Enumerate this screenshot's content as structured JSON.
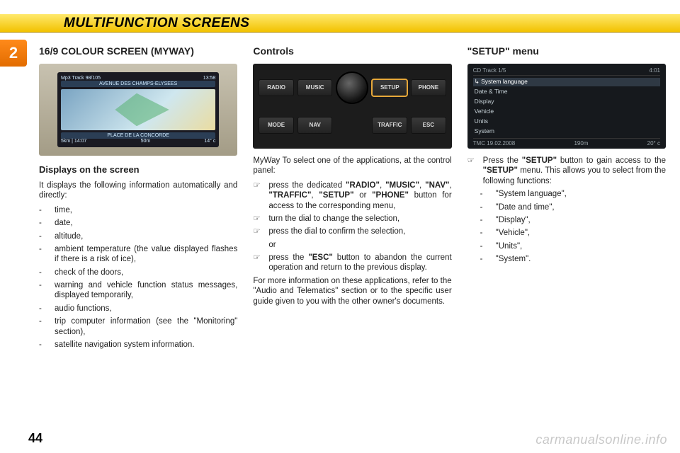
{
  "header": {
    "title": "MULTIFUNCTION SCREENS"
  },
  "chapter": "2",
  "pagenum": "44",
  "watermark": "carmanualsonline.info",
  "col1": {
    "heading": "16/9 COLOUR SCREEN (MYWAY)",
    "screen": {
      "topleft": "Mp3   Track  98/105",
      "topright": "13:58",
      "title": "AVENUE DES CHAMPS-ELYSEES",
      "sub": "PLACE DE LA CONCORDE",
      "botleft": "5km | 14:07",
      "botmid": "50m",
      "botright": "14° c"
    },
    "subheading": "Displays on the screen",
    "intro": "It displays the following information automatically and directly:",
    "items": [
      "time,",
      "date,",
      "altitude,",
      "ambient temperature (the value displayed flashes if there is a risk of ice),",
      "check of the doors,",
      "warning and vehicle function status messages, displayed temporarily,",
      "audio functions,",
      "trip computer information (see the \"Monitoring\" section),",
      "satellite navigation system information."
    ]
  },
  "col2": {
    "heading": "Controls",
    "buttons_row1": [
      "RADIO",
      "MUSIC",
      "",
      "SETUP",
      "PHONE"
    ],
    "buttons_row2": [
      "MODE",
      "NAV",
      "",
      "TRAFFIC",
      "ESC"
    ],
    "intro": "MyWay To select one of the applications, at the control panel:",
    "steps": [
      {
        "pre": "press the dedicated ",
        "bold": "\"RADIO\"",
        "mid1": ", ",
        "bold2": "\"MUSIC\"",
        "mid2": ", ",
        "bold3": "\"NAV\"",
        "mid3": ", ",
        "bold4": "\"TRAFFIC\"",
        "mid4": ", ",
        "bold5": "\"SETUP\"",
        "mid5": " or ",
        "bold6": "\"PHONE\"",
        "post": " button for access to the corresponding menu,"
      },
      {
        "pre": "turn the dial to change the selection,"
      },
      {
        "pre": "press the dial to confirm the selection,"
      },
      {
        "pre": "or"
      },
      {
        "pre": "press the ",
        "bold": "\"ESC\"",
        "post": " button to abandon the current operation and return to the previous display."
      }
    ],
    "outro": "For more information on these applications, refer to the \"Audio and Telematics\" section or to the specific user guide given to you with the other owner's documents."
  },
  "col3": {
    "heading": "\"SETUP\" menu",
    "screen": {
      "topleft": "CD    Track 1/5",
      "topright": "4:01",
      "menu": [
        "System language",
        "Date & Time",
        "Display",
        "Vehicle",
        "Units",
        "System"
      ],
      "botleft": "TMC  19.02.2008",
      "botmid": "190m",
      "botright": "20° c"
    },
    "lead_pre": "Press the ",
    "lead_b1": "\"SETUP\"",
    "lead_mid": " button to gain access to the ",
    "lead_b2": "\"SETUP\"",
    "lead_post": " menu. This allows you to select from the following functions:",
    "items": [
      "\"System language\",",
      "\"Date and time\",",
      "\"Display\",",
      "\"Vehicle\",",
      "\"Units\",",
      "\"System\"."
    ]
  }
}
